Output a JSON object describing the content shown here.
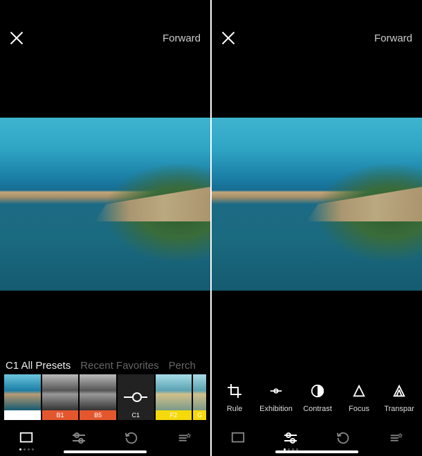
{
  "left": {
    "forward_label": "Forward",
    "tabs": {
      "selected": "C1 All Presets",
      "recent": "Recent Favorites",
      "perch": "Perch"
    },
    "filters": [
      {
        "name": "original",
        "label": "—"
      },
      {
        "name": "B1",
        "label": "B1"
      },
      {
        "name": "B5",
        "label": "B5"
      },
      {
        "name": "C1",
        "label": "C1"
      },
      {
        "name": "F2",
        "label": "F2"
      },
      {
        "name": "G",
        "label": "G"
      }
    ]
  },
  "right": {
    "forward_label": "Forward",
    "tools": [
      {
        "name": "rule",
        "label": "Rule"
      },
      {
        "name": "exhibition",
        "label": "Exhibition"
      },
      {
        "name": "contrast",
        "label": "Contrast"
      },
      {
        "name": "focus",
        "label": "Focus"
      },
      {
        "name": "transparency",
        "label": "Transpar"
      }
    ]
  }
}
